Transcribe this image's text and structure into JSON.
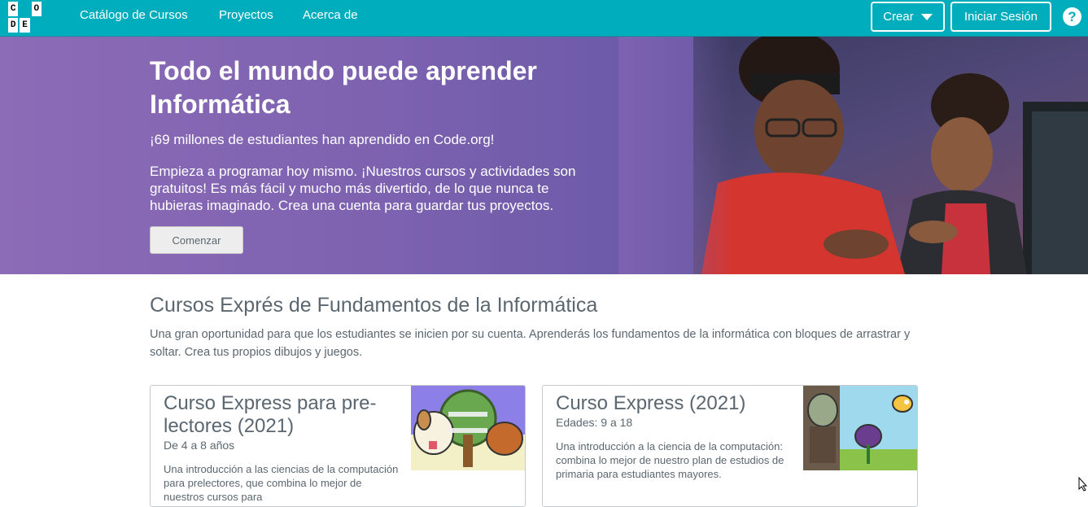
{
  "header": {
    "logo_letters": [
      "C",
      "O",
      "D",
      "E"
    ],
    "nav": [
      "Catálogo de Cursos",
      "Proyectos",
      "Acerca de"
    ],
    "create_label": "Crear",
    "signin_label": "Iniciar Sesión",
    "help_glyph": "?"
  },
  "hero": {
    "title": "Todo el mundo puede aprender Informática",
    "subtitle": "¡69 millones de estudiantes han aprendido en Code.org!",
    "body": "Empieza a programar hoy mismo. ¡Nuestros cursos y actividades son gratuitos! Es más fácil y mucho más divertido, de lo que nunca te hubieras imaginado. Crea una cuenta para guardar tus proyectos.",
    "button_label": "Comenzar"
  },
  "section": {
    "title": "Cursos Exprés de Fundamentos de la Informática",
    "description": "Una gran oportunidad para que los estudiantes se inicien por su cuenta. Aprenderás los fundamentos de la informática con bloques de arrastrar y soltar. Crea tus propios dibujos y juegos."
  },
  "cards": [
    {
      "title": "Curso Express para pre-lectores (2021)",
      "age": "De 4 a 8 años",
      "description": "Una introducción a las ciencias de la computación para prelectores, que combina lo mejor de nuestros cursos para"
    },
    {
      "title": "Curso Express (2021)",
      "age": "Edades: 9 a 18",
      "description": "Una introducción a la ciencia de la computación: combina lo mejor de nuestro plan de estudios de primaria para estudiantes mayores."
    }
  ],
  "colors": {
    "header_bg": "#00adbc",
    "hero_bg": "#7d62b0",
    "text": "#5b6770"
  }
}
